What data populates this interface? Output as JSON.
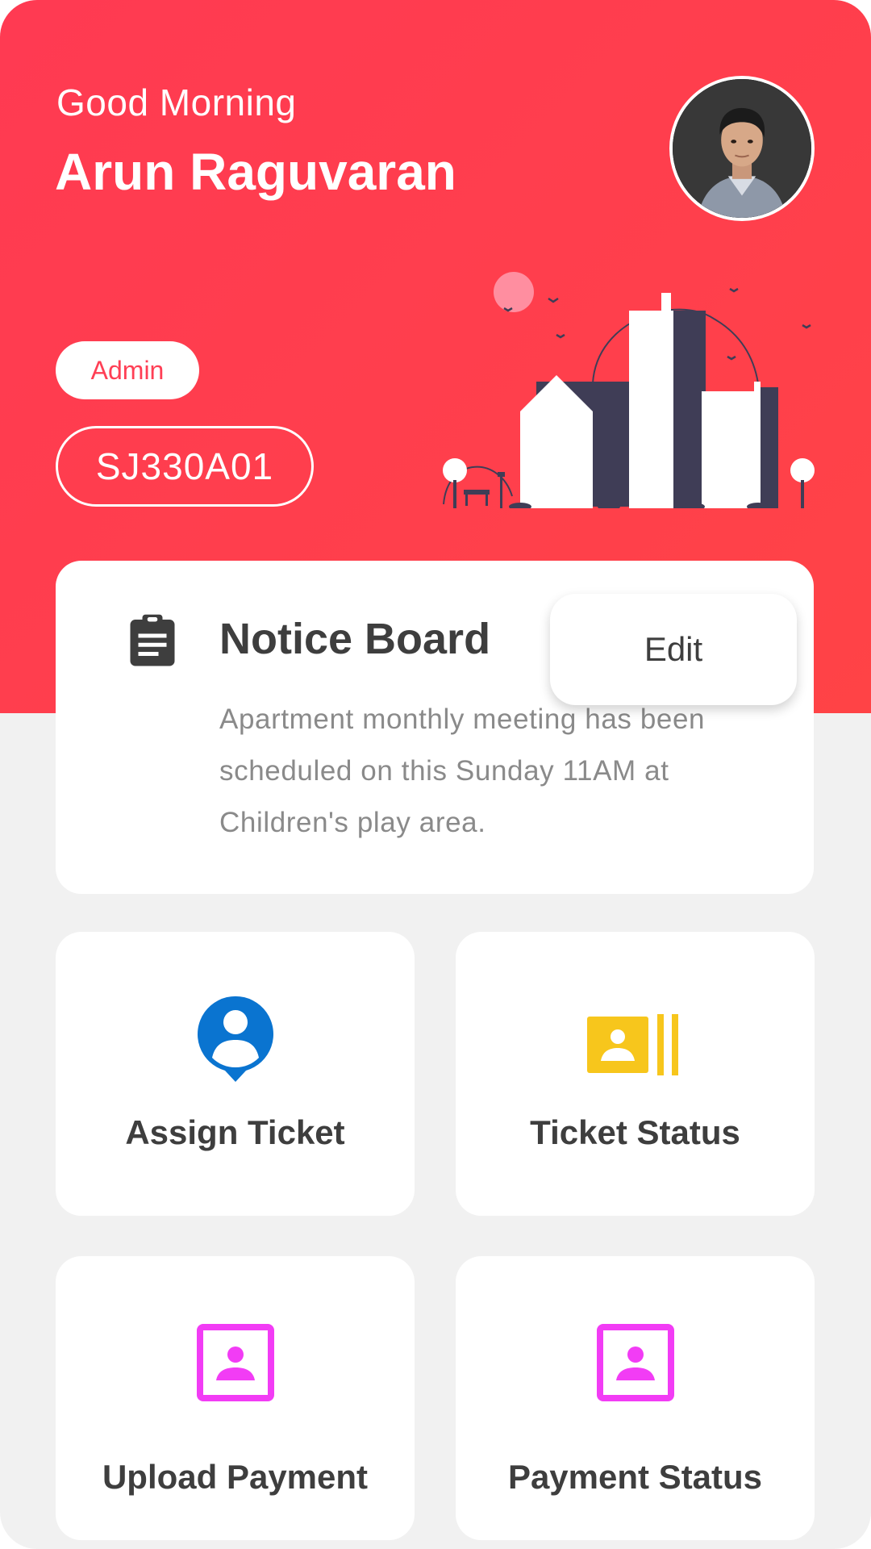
{
  "header": {
    "greeting": "Good Morning",
    "user_name": "Arun Raguvaran",
    "role": "Admin",
    "unit_id": "SJ330A01"
  },
  "notice": {
    "title": "Notice Board",
    "message": "Apartment monthly meeting has been scheduled on this Sunday 11AM at Children's play area.",
    "edit_label": "Edit",
    "icon": "clipboard-icon"
  },
  "actions": [
    {
      "label": "Assign Ticket",
      "icon": "user-pin-icon",
      "color": "#0a74d0"
    },
    {
      "label": "Ticket Status",
      "icon": "id-card-icon",
      "color": "#f7c61c"
    },
    {
      "label": "Upload Payment",
      "icon": "portrait-icon",
      "color": "#f23cf5"
    },
    {
      "label": "Payment Status",
      "icon": "portrait-icon",
      "color": "#f23cf5"
    }
  ],
  "colors": {
    "accent": "#ff3f4f",
    "background": "#f1f1f1",
    "card": "#ffffff",
    "text_dark": "#3e3e3e",
    "text_muted": "#8a8a8a"
  }
}
